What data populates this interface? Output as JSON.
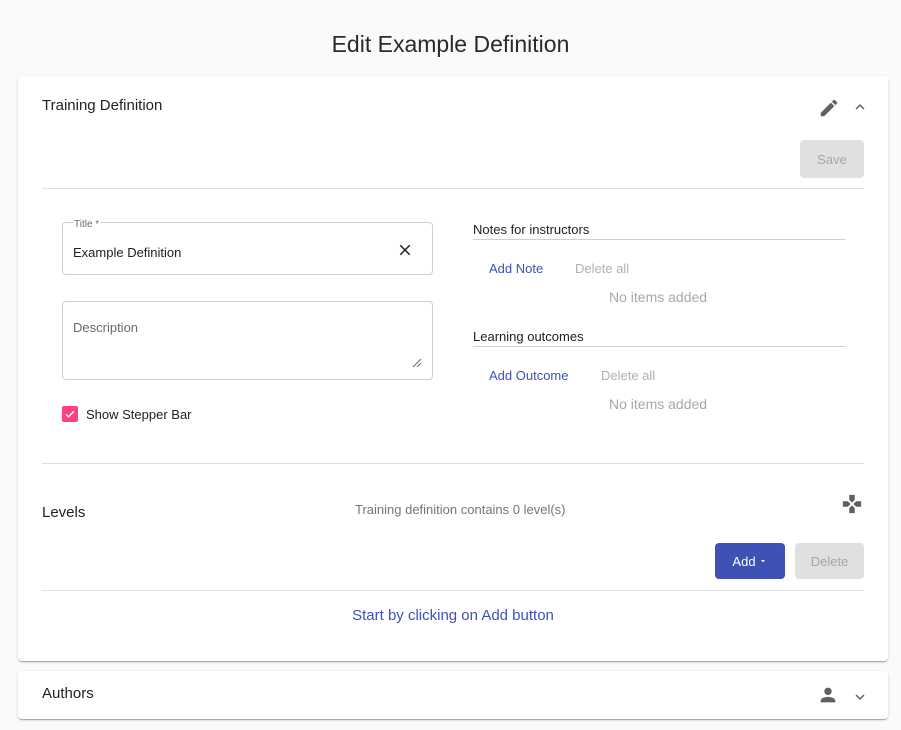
{
  "page": {
    "title": "Edit Example Definition"
  },
  "training_panel": {
    "title": "Training Definition",
    "save_label": "Save",
    "icons": {
      "edit": "pencil-icon",
      "collapse": "chevron-up-icon"
    }
  },
  "form": {
    "title_label": "Title *",
    "title_value": "Example Definition",
    "description_placeholder": "Description",
    "stepper_label": "Show Stepper Bar",
    "stepper_checked": true
  },
  "notes": {
    "heading": "Notes for instructors",
    "add_label": "Add Note",
    "delete_all_label": "Delete all",
    "empty_text": "No items added"
  },
  "outcomes": {
    "heading": "Learning outcomes",
    "add_label": "Add Outcome",
    "delete_all_label": "Delete all",
    "empty_text": "No items added"
  },
  "levels": {
    "title": "Levels",
    "summary": "Training definition contains 0 level(s)",
    "add_label": "Add",
    "delete_label": "Delete",
    "hint": "Start by clicking on Add button"
  },
  "authors_panel": {
    "title": "Authors",
    "icons": {
      "person": "person-icon",
      "expand": "chevron-down-icon"
    }
  },
  "colors": {
    "primary": "#3f51b5",
    "accent": "#ff4081",
    "disabled_bg": "#e0e0e0"
  }
}
